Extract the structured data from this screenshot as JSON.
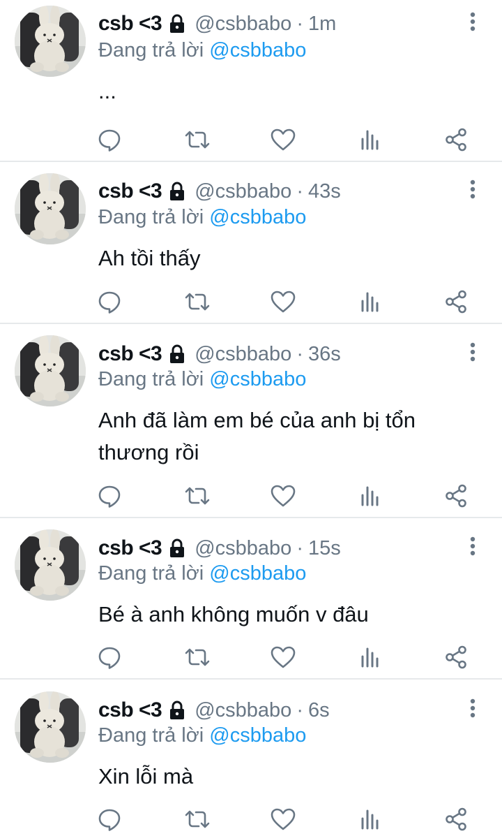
{
  "tweets": [
    {
      "name": "csb <3",
      "handle": "@csbbabo",
      "time": "1m",
      "reply_prefix": "Đang trả lời",
      "reply_to": "@csbbabo",
      "text": "..."
    },
    {
      "name": "csb <3",
      "handle": "@csbbabo",
      "time": "43s",
      "reply_prefix": "Đang trả lời",
      "reply_to": "@csbbabo",
      "text": "Ah tồi thấy"
    },
    {
      "name": "csb <3",
      "handle": "@csbbabo",
      "time": "36s",
      "reply_prefix": "Đang trả lời",
      "reply_to": "@csbbabo",
      "text": "Anh đã làm em bé của anh bị tổn thương rồi"
    },
    {
      "name": "csb <3",
      "handle": "@csbbabo",
      "time": "15s",
      "reply_prefix": "Đang trả lời",
      "reply_to": "@csbbabo",
      "text": "Bé à anh không muốn v đâu"
    },
    {
      "name": "csb <3",
      "handle": "@csbbabo",
      "time": "6s",
      "reply_prefix": "Đang trả lời",
      "reply_to": "@csbbabo",
      "text": "Xin lỗi mà"
    }
  ],
  "separator": "·",
  "icons": {
    "reply": "reply-icon",
    "retweet": "retweet-icon",
    "like": "heart-icon",
    "analytics": "analytics-icon",
    "share": "share-icon",
    "more": "more-vertical-icon",
    "protected": "lock-icon"
  },
  "colors": {
    "text": "#0f1419",
    "secondary": "#687684",
    "mention": "#1d9bf0",
    "divider": "#e6e9eb"
  }
}
